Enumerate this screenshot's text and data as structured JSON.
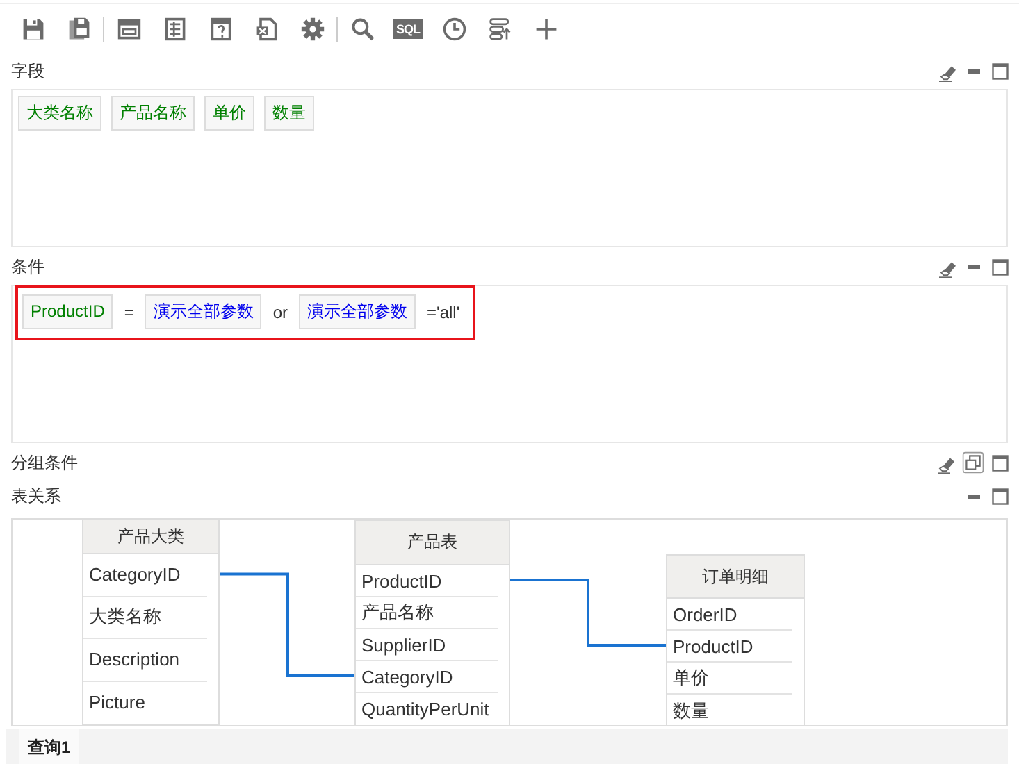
{
  "toolbar": [
    {
      "kind": "save"
    },
    {
      "kind": "save-as"
    },
    {
      "kind": "separator"
    },
    {
      "kind": "form"
    },
    {
      "kind": "list"
    },
    {
      "kind": "help-form"
    },
    {
      "kind": "export"
    },
    {
      "kind": "settings"
    },
    {
      "kind": "separator"
    },
    {
      "kind": "search"
    },
    {
      "kind": "sql",
      "label": "SQL"
    },
    {
      "kind": "clock"
    },
    {
      "kind": "filter"
    },
    {
      "kind": "add"
    }
  ],
  "sections": [
    {
      "kind": "fields",
      "title": "字段",
      "tools": [
        {
          "kind": "clear"
        },
        {
          "kind": "minimize"
        },
        {
          "kind": "maximize"
        }
      ],
      "items": [
        {
          "text": "大类名称"
        },
        {
          "text": "产品名称"
        },
        {
          "text": "单价"
        },
        {
          "text": "数量"
        }
      ]
    },
    {
      "kind": "condition",
      "title": "条件",
      "tools": [
        {
          "kind": "clear"
        },
        {
          "kind": "minimize"
        },
        {
          "kind": "maximize"
        }
      ],
      "highlighted": true,
      "items": [
        {
          "kind": "field",
          "text": "ProductID"
        },
        {
          "kind": "operator",
          "text": "="
        },
        {
          "kind": "param",
          "text": "演示全部参数"
        },
        {
          "kind": "operator",
          "text": "or"
        },
        {
          "kind": "param",
          "text": "演示全部参数"
        },
        {
          "kind": "operator",
          "text": "='all'"
        }
      ]
    },
    {
      "kind": "collapsed",
      "title": "分组条件",
      "tools": [
        {
          "kind": "clear"
        },
        {
          "kind": "restore"
        },
        {
          "kind": "maximize"
        }
      ]
    },
    {
      "kind": "diagram",
      "title": "表关系",
      "tools": [
        {
          "kind": "minimize"
        },
        {
          "kind": "maximize"
        }
      ],
      "tables": [
        {
          "name": "产品大类",
          "fields": [
            {
              "name": "CategoryID",
              "kind": "link-right"
            },
            {
              "name": "大类名称",
              "kind": "plain"
            },
            {
              "name": "Description",
              "kind": "plain"
            },
            {
              "name": "Picture",
              "kind": "plain"
            }
          ]
        },
        {
          "name": "产品表",
          "fields": [
            {
              "name": "ProductID",
              "kind": "link-right"
            },
            {
              "name": "产品名称",
              "kind": "plain"
            },
            {
              "name": "SupplierID",
              "kind": "plain"
            },
            {
              "name": "CategoryID",
              "kind": "link-left"
            },
            {
              "name": "QuantityPerUnit",
              "kind": "plain"
            }
          ]
        },
        {
          "name": "订单明细",
          "fields": [
            {
              "name": "OrderID",
              "kind": "plain"
            },
            {
              "name": "ProductID",
              "kind": "link-left"
            },
            {
              "name": "单价",
              "kind": "plain"
            },
            {
              "name": "数量",
              "kind": "plain"
            }
          ]
        }
      ]
    }
  ],
  "tabs": [
    {
      "label": "查询1",
      "selected": true
    }
  ]
}
